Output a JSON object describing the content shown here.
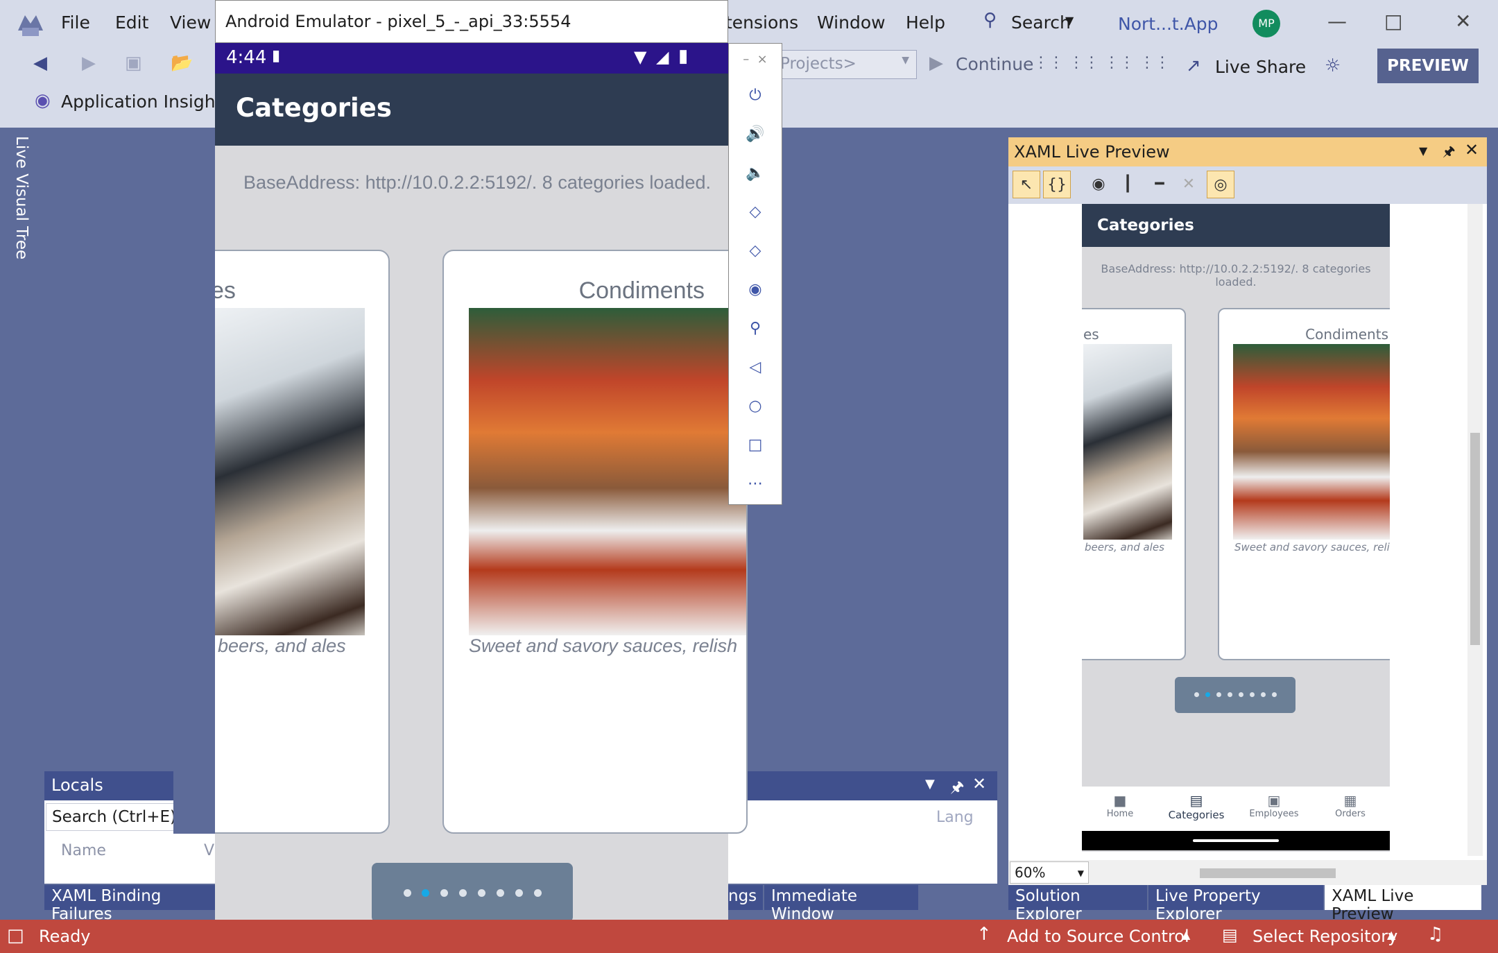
{
  "vs": {
    "menu": [
      "File",
      "Edit",
      "View",
      "tensions",
      "Window",
      "Help"
    ],
    "search_label": "Search",
    "solution_name": "Nort...t.App",
    "avatar_initials": "MP",
    "projects_dropdown": "Projects>",
    "continue_label": "Continue",
    "live_share_label": "Live Share",
    "preview_label": "PREVIEW",
    "app_insights_label": "Application Insights",
    "live_visual_tree_label": "Live Visual Tree"
  },
  "emulator": {
    "title": "Android Emulator - pixel_5_-_api_33:5554",
    "time": "4:44",
    "side_toolbar": [
      "power-icon",
      "volume-up-icon",
      "volume-down-icon",
      "rotate-left-icon",
      "rotate-right-icon",
      "camera-icon",
      "zoom-icon",
      "back-icon",
      "home-icon",
      "overview-icon",
      "more-icon"
    ]
  },
  "app": {
    "page_title": "Categories",
    "status_text": "BaseAddress: http://10.0.2.2:5192/. 8 categories loaded.",
    "cards": [
      {
        "title_fragment": "es",
        "description": "beers, and ales",
        "image": "coffee-pour-image"
      },
      {
        "title": "Condiments",
        "description": "Sweet and savory sauces, relish",
        "image": "spice-jars-image"
      }
    ],
    "indicator": {
      "total": 8,
      "active_index": 1
    }
  },
  "locals": {
    "title": "Locals",
    "search_placeholder": "Search (Ctrl+E)",
    "column_name": "Name",
    "column_v": "V",
    "column_lang": "Lang"
  },
  "bottom_tabs_left": [
    "XAML Binding Failures"
  ],
  "bottom_tabs_mid": [
    "ngs",
    "Immediate Window"
  ],
  "bottom_tabs_right": [
    "Solution Explorer",
    "Live Property Explorer",
    "XAML Live Preview"
  ],
  "xaml_preview": {
    "title": "XAML Live Preview",
    "zoom": "60%",
    "nav": [
      "Home",
      "Categories",
      "Employees",
      "Orders"
    ],
    "active_nav": "Categories"
  },
  "status_bar": {
    "ready": "Ready",
    "source_control": "Add to Source Control",
    "repository": "Select Repository"
  }
}
